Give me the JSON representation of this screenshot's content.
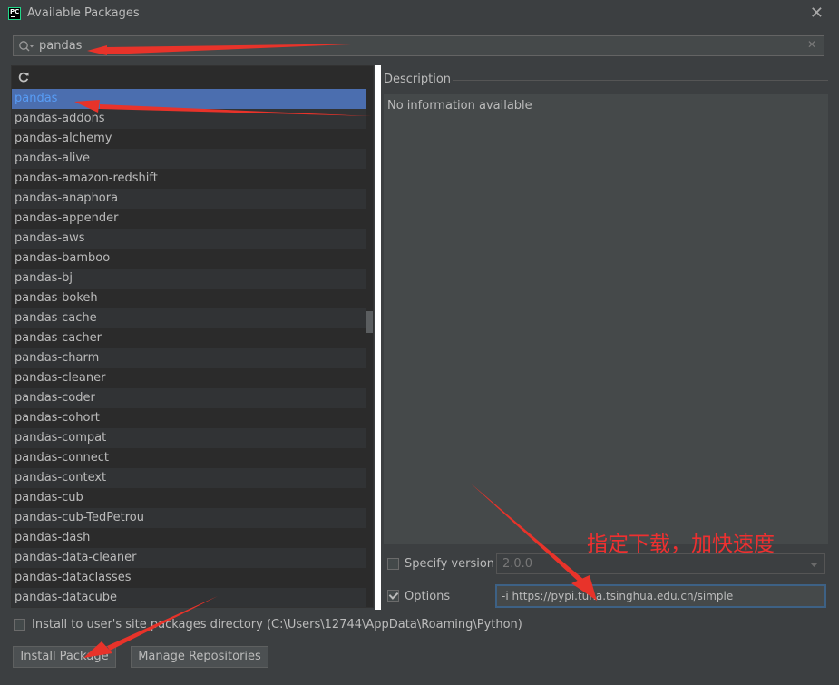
{
  "window": {
    "title": "Available Packages",
    "close_symbol": "✕",
    "app_icon_text": "PC"
  },
  "search": {
    "value": "pandas",
    "icon": "search-icon",
    "clear_symbol": "✕"
  },
  "list": {
    "reload_icon": "refresh-icon",
    "selected_index": 0,
    "packages": [
      "pandas",
      "pandas-addons",
      "pandas-alchemy",
      "pandas-alive",
      "pandas-amazon-redshift",
      "pandas-anaphora",
      "pandas-appender",
      "pandas-aws",
      "pandas-bamboo",
      "pandas-bj",
      "pandas-bokeh",
      "pandas-cache",
      "pandas-cacher",
      "pandas-charm",
      "pandas-cleaner",
      "pandas-coder",
      "pandas-cohort",
      "pandas-compat",
      "pandas-connect",
      "pandas-context",
      "pandas-cub",
      "pandas-cub-TedPetrou",
      "pandas-dash",
      "pandas-data-cleaner",
      "pandas-dataclasses",
      "pandas-datacube"
    ]
  },
  "description": {
    "label": "Description",
    "text": "No information available"
  },
  "specify_version": {
    "label": "Specify version",
    "checked": false,
    "value": "2.0.0"
  },
  "options": {
    "label": "Options",
    "checked": true,
    "value": "-i https://pypi.tuna.tsinghua.edu.cn/simple"
  },
  "annotation": {
    "text": "指定下载，加快速度",
    "color": "#ee3030"
  },
  "install_user": {
    "label": "Install to user's site packages directory (C:\\Users\\12744\\AppData\\Roaming\\Python)",
    "checked": false
  },
  "buttons": {
    "install_mnemonic": "I",
    "install_rest": "nstall Package",
    "manage_mnemonic": "M",
    "manage_rest": "anage Repositories"
  },
  "colors": {
    "background": "#3c3f41",
    "list_background": "#2b2b2b",
    "selection": "#4b6eaf",
    "arrow_red": "#e8332a"
  }
}
